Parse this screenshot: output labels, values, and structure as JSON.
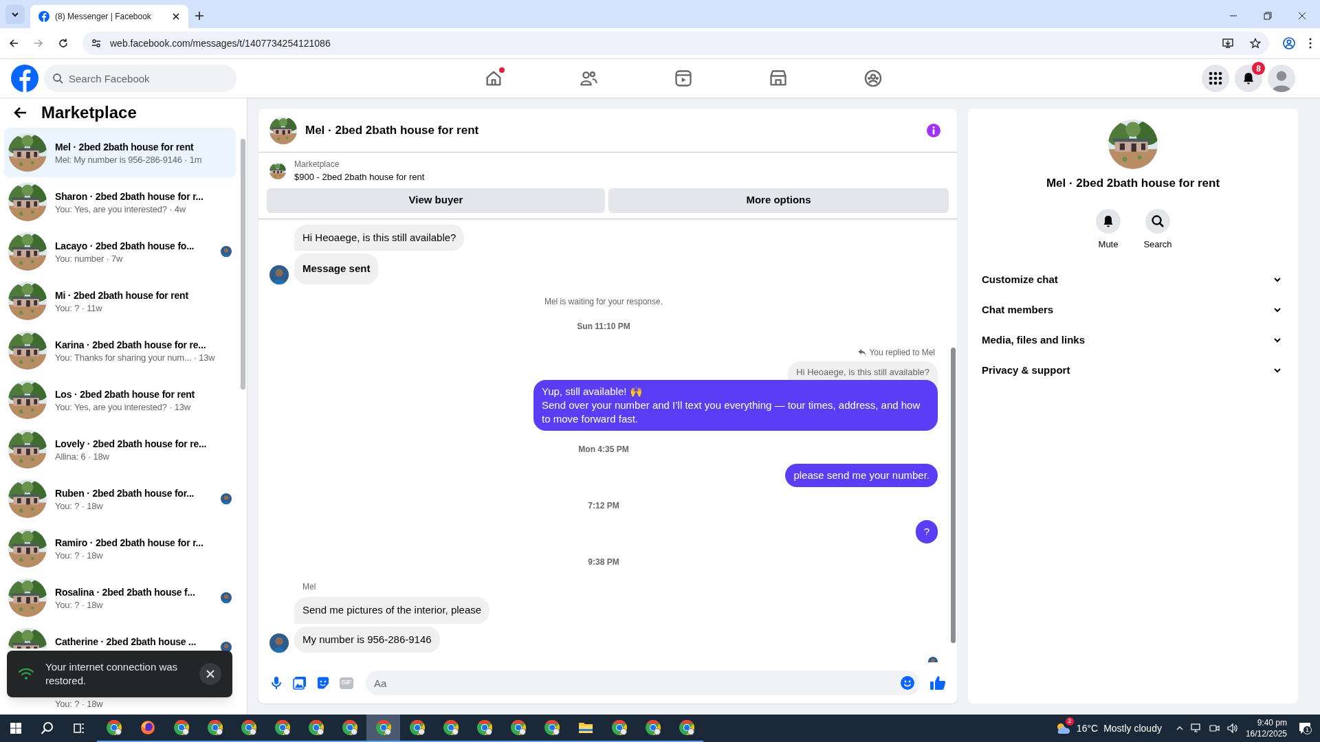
{
  "browser": {
    "tab_title": "(8) Messenger | Facebook",
    "url": "web.facebook.com/messages/t/1407734254121086"
  },
  "header": {
    "search_placeholder": "Search Facebook",
    "nav": [
      {
        "kind": "home",
        "selected": false,
        "dot": true
      },
      {
        "kind": "friends",
        "selected": false,
        "dot": false
      },
      {
        "kind": "video",
        "selected": false,
        "dot": false
      },
      {
        "kind": "marketplace",
        "selected": false,
        "dot": false
      },
      {
        "kind": "groups",
        "selected": false,
        "dot": false
      }
    ],
    "notification_count": "8"
  },
  "sidebar": {
    "title": "Marketplace",
    "conversations": [
      {
        "title": "Mel · 2bed 2bath house for rent",
        "preview": "Mel: My number is 956-286-9146 · 1m",
        "selected": true,
        "seen": false
      },
      {
        "title": "Sharon · 2bed 2bath house for r...",
        "preview": "You: Yes, are you interested? · 4w",
        "selected": false,
        "seen": false
      },
      {
        "title": "Lacayo · 2bed 2bath house fo...",
        "preview": "You: number · 7w",
        "selected": false,
        "seen": true
      },
      {
        "title": "Mi · 2bed 2bath house for rent",
        "preview": "You: ? · 11w",
        "selected": false,
        "seen": false
      },
      {
        "title": "Karina · 2bed 2bath house for re...",
        "preview": "You: Thanks for sharing your num... · 13w",
        "selected": false,
        "seen": false
      },
      {
        "title": "Los · 2bed 2bath house for rent",
        "preview": "You: Yes, are you interested? · 13w",
        "selected": false,
        "seen": false
      },
      {
        "title": "Lovely · 2bed 2bath house for re...",
        "preview": "Allina: 6 · 18w",
        "selected": false,
        "seen": false
      },
      {
        "title": "Ruben · 2bed 2bath house for...",
        "preview": "You: ? · 18w",
        "selected": false,
        "seen": true
      },
      {
        "title": "Ramiro · 2bed 2bath house for r...",
        "preview": "You: ? · 18w",
        "selected": false,
        "seen": false
      },
      {
        "title": "Rosalina · 2bed 2bath house f...",
        "preview": "You: ? · 18w",
        "selected": false,
        "seen": true
      },
      {
        "title": "Catherine · 2bed 2bath house ...",
        "selected": false,
        "seen": true
      },
      {
        "preview": "You: ? · 18w",
        "selected": false,
        "seen": false
      }
    ],
    "toast": "Your internet connection was restored."
  },
  "chat": {
    "title": "Mel · 2bed 2bath house for rent",
    "listing": {
      "label": "Marketplace",
      "name": "$900 - 2bed 2bath house for rent"
    },
    "buttons": [
      "View buyer",
      "More options"
    ],
    "messages": [
      {
        "kind": "incoming",
        "text": "Hi Heoaege, is this still available?",
        "avatar": false,
        "emphasis": false
      },
      {
        "kind": "incoming",
        "text": "Message sent",
        "avatar": true,
        "emphasis": true
      },
      {
        "kind": "notice",
        "text": "Mel is waiting for your response."
      },
      {
        "kind": "timestamp",
        "text": "Sun 11:10 PM"
      },
      {
        "kind": "reply_label",
        "text": "You replied to Mel"
      },
      {
        "kind": "quoted",
        "text": "Hi Heoaege, is this still available?"
      },
      {
        "kind": "outgoing",
        "lines": [
          "Yup, still available! 🙌",
          "Send over your number and I’ll text you everything — tour times, address, and how to move forward fast."
        ]
      },
      {
        "kind": "timestamp",
        "text": "Mon 4:35 PM"
      },
      {
        "kind": "outgoing",
        "lines": [
          "please send me your number."
        ]
      },
      {
        "kind": "timestamp",
        "text": "7:12 PM"
      },
      {
        "kind": "outgoing",
        "lines": [
          "?"
        ]
      },
      {
        "kind": "timestamp",
        "text": "9:38 PM"
      },
      {
        "kind": "sender",
        "text": "Mel"
      },
      {
        "kind": "incoming",
        "text": "Send me pictures of the interior, please",
        "avatar": false,
        "emphasis": false
      },
      {
        "kind": "incoming",
        "text": "My number is 956-286-9146",
        "avatar": true,
        "emphasis": false
      },
      {
        "kind": "seen"
      }
    ],
    "composer": {
      "placeholder": "Aa",
      "gif": "GIF"
    }
  },
  "details": {
    "title": "Mel · 2bed 2bath house for rent",
    "actions": [
      {
        "kind": "mute",
        "label": "Mute"
      },
      {
        "kind": "search",
        "label": "Search"
      }
    ],
    "sections": [
      {
        "label": "Customize chat",
        "expanded": false
      },
      {
        "label": "Chat members",
        "expanded": false
      },
      {
        "label": "Media, files and links",
        "expanded": false
      },
      {
        "label": "Privacy & support",
        "expanded": false
      }
    ]
  },
  "taskbar": {
    "apps": [
      {
        "kind": "chrome",
        "selected": false
      },
      {
        "kind": "firefox",
        "selected": false
      },
      {
        "kind": "chrome",
        "selected": false
      },
      {
        "kind": "chrome",
        "selected": false
      },
      {
        "kind": "chrome",
        "selected": false
      },
      {
        "kind": "chrome",
        "selected": false
      },
      {
        "kind": "chrome",
        "selected": false
      },
      {
        "kind": "chrome",
        "selected": false
      },
      {
        "kind": "chrome",
        "selected": true
      },
      {
        "kind": "chrome",
        "selected": false
      },
      {
        "kind": "chrome",
        "selected": false
      },
      {
        "kind": "chrome",
        "selected": false
      },
      {
        "kind": "chrome",
        "selected": false
      },
      {
        "kind": "chrome",
        "selected": false
      },
      {
        "kind": "folder",
        "selected": false
      },
      {
        "kind": "chrome",
        "selected": false
      },
      {
        "kind": "chrome",
        "selected": false
      },
      {
        "kind": "chrome",
        "selected": false
      }
    ],
    "weather_badge": "2",
    "temperature": "16°C",
    "weather": "Mostly cloudy",
    "time": "9:40 pm",
    "date": "16/12/2025",
    "notifications": "1"
  }
}
